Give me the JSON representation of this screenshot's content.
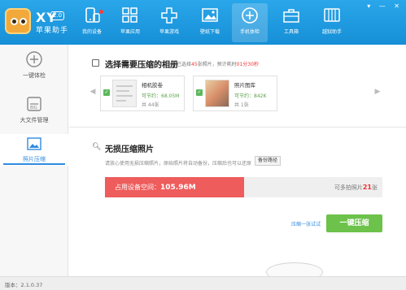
{
  "app": {
    "name": "XY",
    "version_badge": "2.0",
    "subtitle": "苹果助手"
  },
  "nav": [
    {
      "label": "我的设备"
    },
    {
      "label": "苹果应用"
    },
    {
      "label": "苹果游戏"
    },
    {
      "label": "壁纸下载"
    },
    {
      "label": "手机体检"
    },
    {
      "label": "工具箱"
    },
    {
      "label": "越狱助手"
    }
  ],
  "sidebar": [
    {
      "label": "一键体检"
    },
    {
      "label": "大文件管理"
    },
    {
      "label": "照片压缩"
    }
  ],
  "albums_section": {
    "title": "选择需要压缩的相册",
    "status_prefix": "已选择",
    "status_count": "45",
    "status_mid": "张照片，预计耗时",
    "status_time": "01分30秒",
    "albums": [
      {
        "name": "相机胶卷",
        "save": "可节约：68.05M",
        "count": "共 44张"
      },
      {
        "name": "照片图库",
        "save": "可节约：842K",
        "count": "共 1张"
      }
    ]
  },
  "compress_section": {
    "title": "无损压缩照片",
    "note": "请放心使用无损压缩照片，原始照片将自动备份，压缩后也可以还原",
    "backup_button": "备份路径",
    "space_label": "占用设备空间：",
    "space_value": "105.96M",
    "more_label_prefix": "可多拍照片",
    "more_count": "21",
    "more_label_suffix": "张",
    "usage_fraction": 0.5,
    "once_link": "压缩一张试试",
    "compress_button": "一键压缩"
  },
  "footer": {
    "version": "版本：2.1.0.37"
  },
  "colors": {
    "accent": "#2f8be0",
    "header": "#1e9ae2",
    "used": "#ee5c5c",
    "button": "#6cc24a"
  }
}
